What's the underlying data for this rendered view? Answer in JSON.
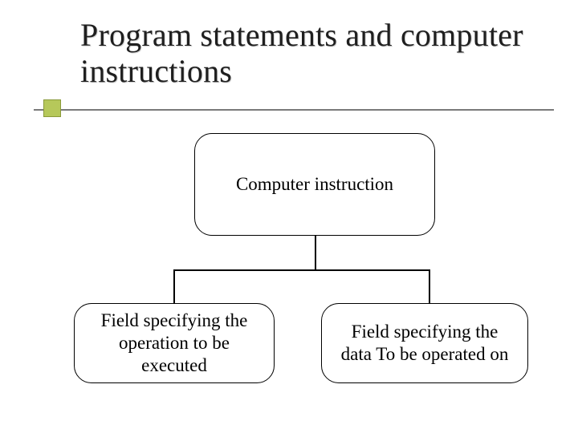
{
  "title": "Program statements and computer instructions",
  "diagram": {
    "root": "Computer instruction",
    "left": "Field specifying the operation to be executed",
    "right": "Field specifying the data To be operated on"
  }
}
